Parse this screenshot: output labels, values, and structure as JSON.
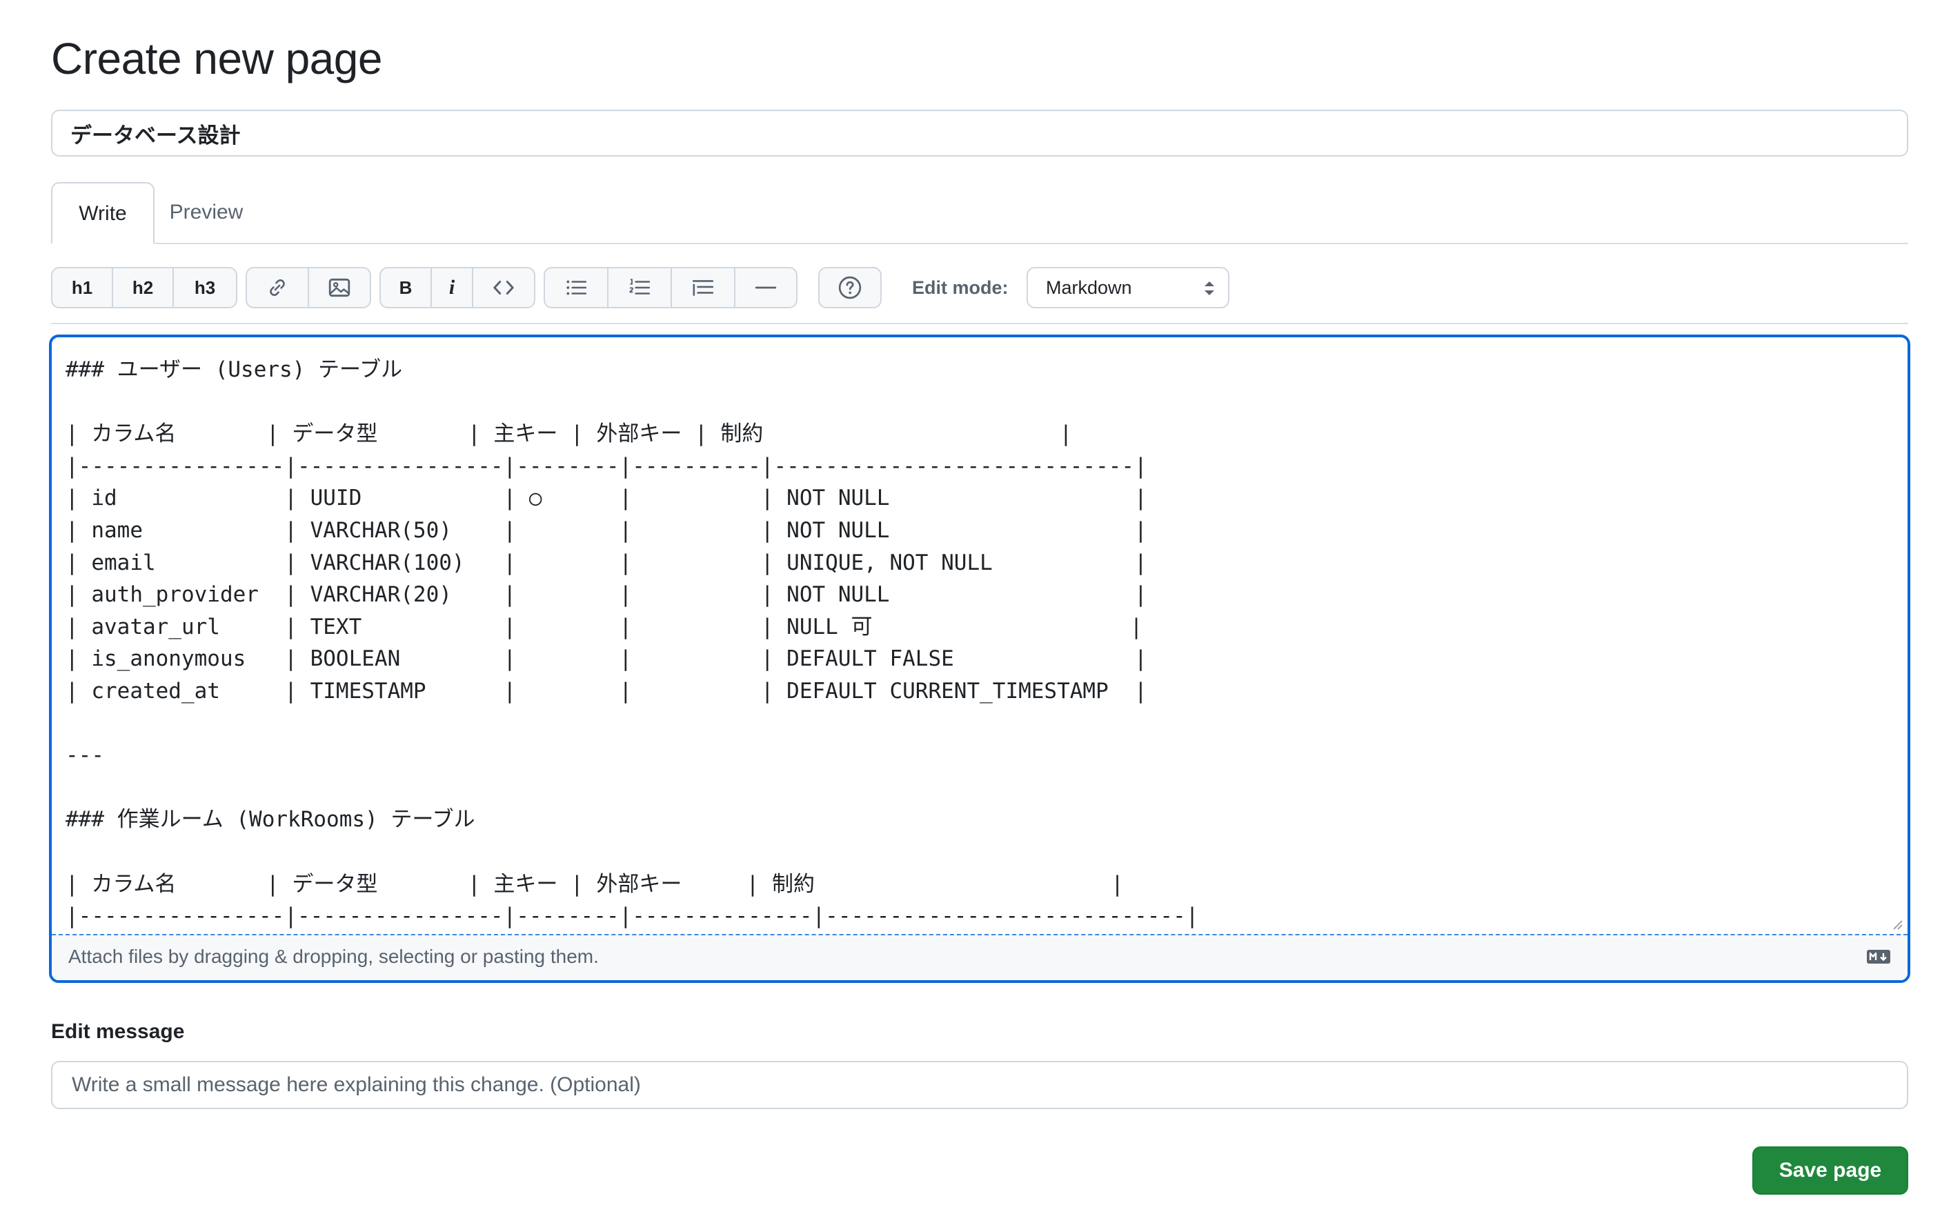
{
  "page": {
    "title": "Create new page"
  },
  "form": {
    "page_title_value": "データベース設計"
  },
  "tabs": [
    {
      "label": "Write",
      "active": true
    },
    {
      "label": "Preview",
      "active": false
    }
  ],
  "toolbar": {
    "h1": "h1",
    "h2": "h2",
    "h3": "h3",
    "bold": "B",
    "italic": "i",
    "icons": [
      "link-icon",
      "image-icon",
      "code-icon",
      "unordered-list-icon",
      "ordered-list-icon",
      "task-list-icon",
      "horizontal-rule-icon",
      "help-icon"
    ],
    "edit_mode_label": "Edit mode:",
    "edit_mode_value": "Markdown"
  },
  "editor": {
    "content": "### ユーザー (Users) テーブル\n\n| カラム名       | データ型       | 主キー | 外部キー | 制約                       |\n|----------------|----------------|--------|----------|----------------------------|\n| id             | UUID           | ○      |          | NOT NULL                   |\n| name           | VARCHAR(50)    |        |          | NOT NULL                   |\n| email          | VARCHAR(100)   |        |          | UNIQUE, NOT NULL           |\n| auth_provider  | VARCHAR(20)    |        |          | NOT NULL                   |\n| avatar_url     | TEXT           |        |          | NULL 可                    |\n| is_anonymous   | BOOLEAN        |        |          | DEFAULT FALSE              |\n| created_at     | TIMESTAMP      |        |          | DEFAULT CURRENT_TIMESTAMP  |\n\n---\n\n### 作業ルーム (WorkRooms) テーブル\n\n| カラム名       | データ型       | 主キー | 外部キー     | 制約                       |\n|----------------|----------------|--------|--------------|----------------------------|",
    "attach_text": "Attach files by dragging & dropping, selecting or pasting them."
  },
  "edit_message": {
    "label": "Edit message",
    "placeholder": "Write a small message here explaining this change. (Optional)"
  },
  "actions": {
    "save_label": "Save page"
  },
  "colors": {
    "accent": "#0969da",
    "save_button": "#1f883d",
    "border": "#d0d7de",
    "muted_text": "#59636e"
  }
}
